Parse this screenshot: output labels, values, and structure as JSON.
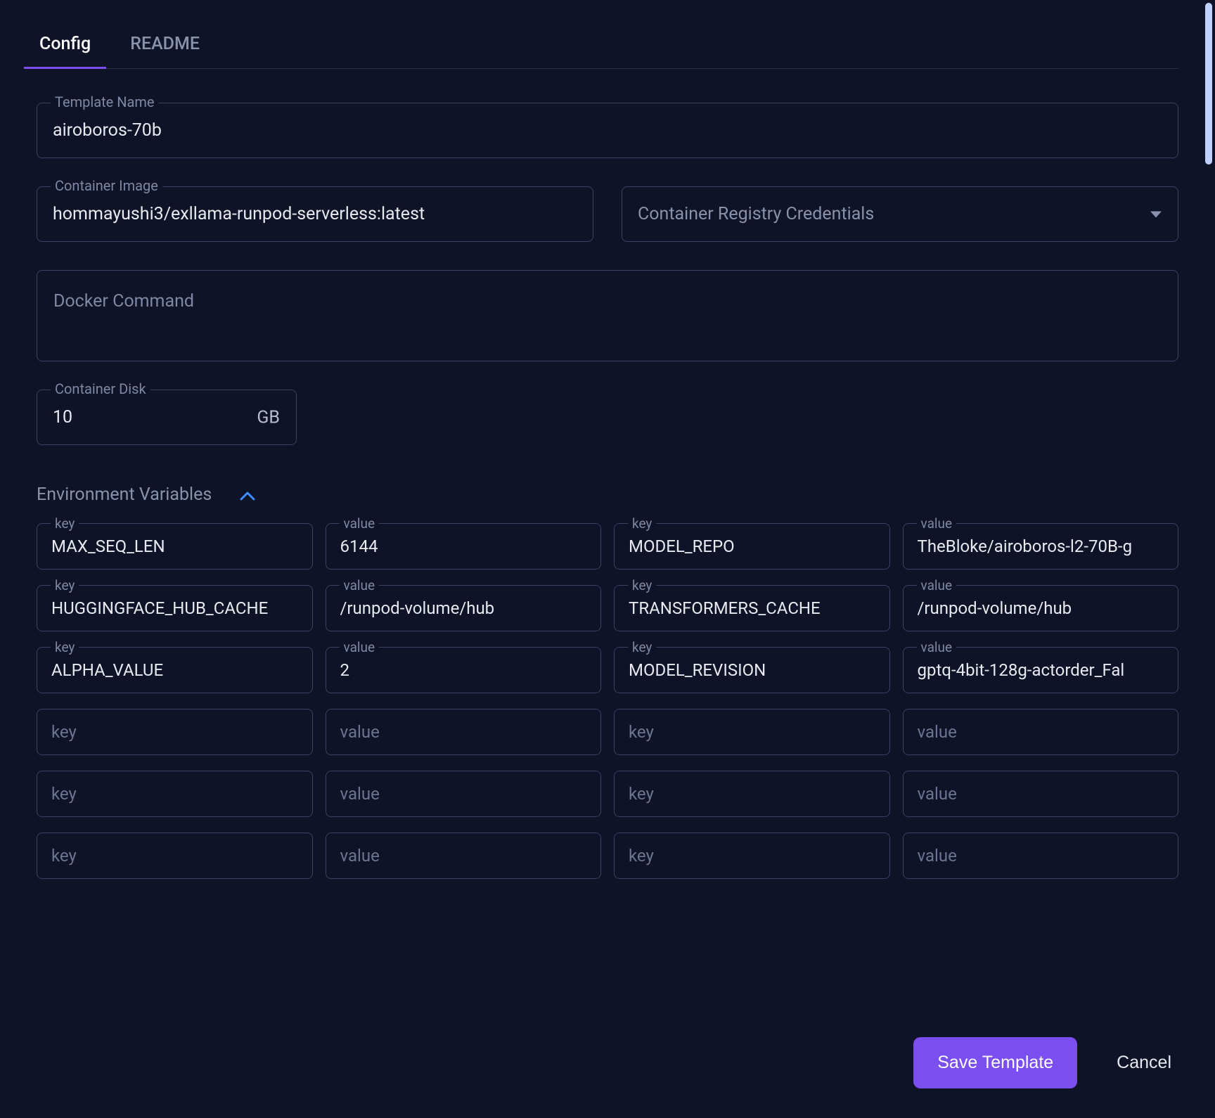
{
  "tabs": {
    "config": "Config",
    "readme": "README"
  },
  "labels": {
    "templateName": "Template Name",
    "containerImage": "Container Image",
    "registryCreds": "Container Registry Credentials",
    "dockerCommand": "Docker Command",
    "containerDisk": "Container Disk",
    "diskUnit": "GB",
    "envSection": "Environment Variables",
    "key": "key",
    "value": "value"
  },
  "values": {
    "templateName": "airoboros-70b",
    "containerImage": "hommayushi3/exllama-runpod-serverless:latest",
    "dockerCommand": "",
    "containerDisk": "10"
  },
  "env": [
    {
      "key": "MAX_SEQ_LEN",
      "value": "6144"
    },
    {
      "key": "MODEL_REPO",
      "value": "TheBloke/airoboros-l2-70B-g"
    },
    {
      "key": "HUGGINGFACE_HUB_CACHE",
      "value": "/runpod-volume/hub"
    },
    {
      "key": "TRANSFORMERS_CACHE",
      "value": "/runpod-volume/hub"
    },
    {
      "key": "ALPHA_VALUE",
      "value": "2"
    },
    {
      "key": "MODEL_REVISION",
      "value": "gptq-4bit-128g-actorder_Fal"
    },
    {
      "key": "",
      "value": ""
    },
    {
      "key": "",
      "value": ""
    },
    {
      "key": "",
      "value": ""
    },
    {
      "key": "",
      "value": ""
    },
    {
      "key": "",
      "value": ""
    },
    {
      "key": "",
      "value": ""
    }
  ],
  "buttons": {
    "save": "Save Template",
    "cancel": "Cancel"
  },
  "colors": {
    "accent": "#7b4ef0",
    "bg": "#0e1327",
    "border": "#3b4164"
  }
}
